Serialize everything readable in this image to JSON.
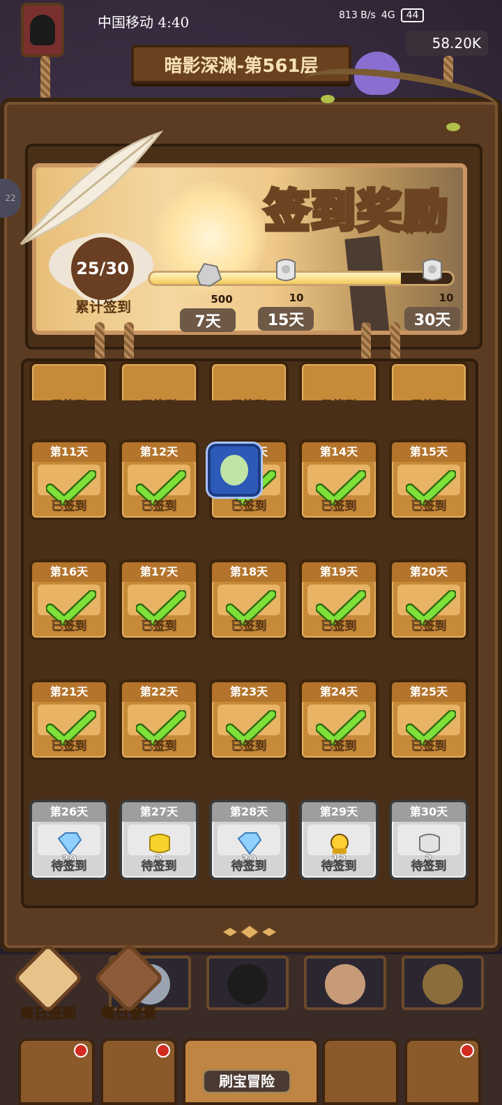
{
  "statusbar": {
    "carrier": "中国移动 4:40",
    "speed": "813 B/s",
    "network": "4G",
    "battery": "44"
  },
  "header": {
    "level_title": "暗影深渊-第561层",
    "currency": "58.20K"
  },
  "rewards": {
    "title": "签到奖励",
    "progress_text": "25/30",
    "progress_label": "累计签到",
    "progress_fraction": 0.83,
    "milestones": [
      {
        "amount": "500",
        "day": "7天",
        "icon": "silver-ore-icon"
      },
      {
        "amount": "10",
        "day": "15天",
        "icon": "silver-scroll-icon"
      },
      {
        "amount": "10",
        "day": "30天",
        "icon": "silver-scroll-icon"
      }
    ]
  },
  "checkin": {
    "status_done": "已签到",
    "status_pending": "待签到",
    "rows": [
      [
        "第11天",
        "第12天",
        "第13天",
        "第14天",
        "第15天"
      ],
      [
        "第16天",
        "第17天",
        "第18天",
        "第19天",
        "第20天"
      ],
      [
        "第21天",
        "第22天",
        "第23天",
        "第24天",
        "第25天"
      ]
    ],
    "pending": [
      {
        "day": "第26天",
        "amount": "30",
        "icon": "diamond-icon"
      },
      {
        "day": "第27天",
        "amount": "2",
        "icon": "gold-scroll-icon"
      },
      {
        "day": "第28天",
        "amount": "30",
        "icon": "diamond-icon"
      },
      {
        "day": "第29天",
        "amount": "12",
        "icon": "hero-shard-icon"
      },
      {
        "day": "第30天",
        "amount": "2",
        "icon": "silver-scroll-icon"
      }
    ]
  },
  "bottom": {
    "daily_checkin": "每日签到",
    "daily_login": "每日登录",
    "nav_active": "刷宝冒险"
  },
  "colors": {
    "done_card": "#c68a39",
    "pending_card": "#d4d4d4",
    "check_green": "#6fd12c"
  }
}
